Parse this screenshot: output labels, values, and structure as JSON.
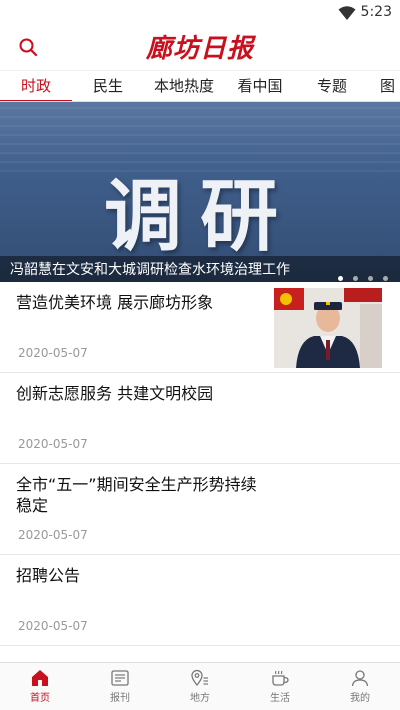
{
  "status_bar": {
    "time": "5:23",
    "wifi_icon": "wifi-icon"
  },
  "header": {
    "logo_text": "廊坊日报",
    "search_icon": "search-icon",
    "brand_color": "#c8101e"
  },
  "tabs": [
    {
      "label": "时政",
      "active": true
    },
    {
      "label": "民生",
      "active": false
    },
    {
      "label": "本地热度",
      "active": false
    },
    {
      "label": "看中国",
      "active": false
    },
    {
      "label": "专题",
      "active": false
    },
    {
      "label": "图",
      "active": false
    }
  ],
  "banner": {
    "image_text": "调研",
    "caption": "冯韶慧在文安和大城调研检查水环境治理工作",
    "page_count": 4,
    "active_index": 0
  },
  "news": [
    {
      "title": "营造优美环境 展示廊坊形象",
      "date": "2020-05-07",
      "has_thumb": true
    },
    {
      "title": "创新志愿服务 共建文明校园",
      "date": "2020-05-07",
      "has_thumb": false
    },
    {
      "title": "全市“五一”期间安全生产形势持续稳定",
      "date": "2020-05-07",
      "has_thumb": false
    },
    {
      "title": "招聘公告",
      "date": "2020-05-07",
      "has_thumb": false
    }
  ],
  "bottom_nav": [
    {
      "label": "首页",
      "icon": "home-icon",
      "active": true
    },
    {
      "label": "报刊",
      "icon": "newspaper-icon",
      "active": false
    },
    {
      "label": "地方",
      "icon": "map-pin-icon",
      "active": false
    },
    {
      "label": "生活",
      "icon": "coffee-cup-icon",
      "active": false
    },
    {
      "label": "我的",
      "icon": "user-icon",
      "active": false
    }
  ]
}
